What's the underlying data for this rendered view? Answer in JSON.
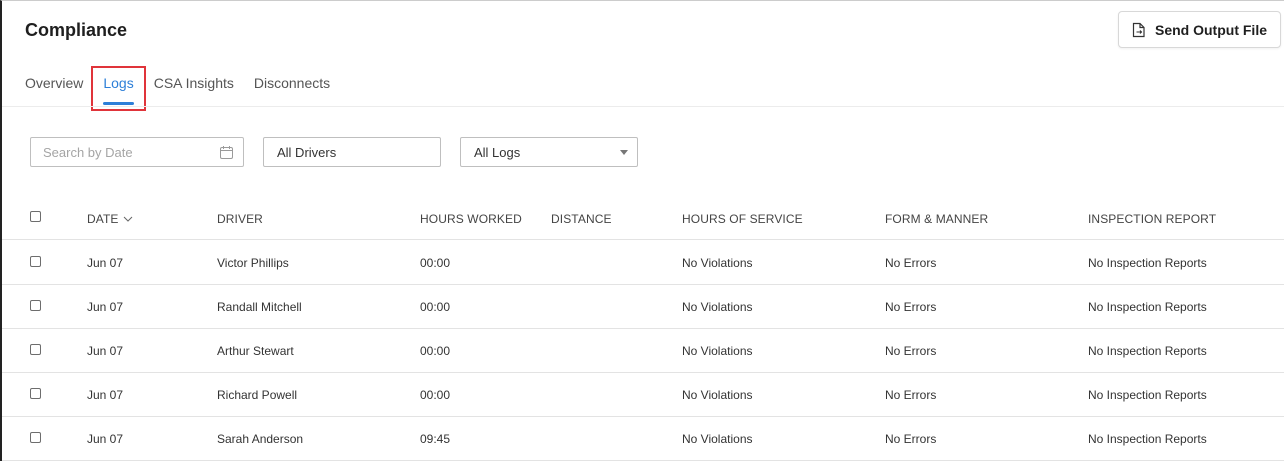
{
  "header": {
    "title": "Compliance",
    "send_button_label": "Send Output File"
  },
  "tabs": [
    {
      "label": "Overview"
    },
    {
      "label": "Logs",
      "active": true
    },
    {
      "label": "CSA Insights"
    },
    {
      "label": "Disconnects"
    }
  ],
  "filters": {
    "date_placeholder": "Search by Date",
    "drivers_value": "All Drivers",
    "logs_value": "All Logs"
  },
  "table": {
    "columns": [
      "DATE",
      "DRIVER",
      "HOURS WORKED",
      "DISTANCE",
      "HOURS OF SERVICE",
      "FORM & MANNER",
      "INSPECTION REPORT"
    ],
    "rows": [
      {
        "date": "Jun 07",
        "driver": "Victor Phillips",
        "hours": "00:00",
        "distance": "",
        "hos": "No Violations",
        "form": "No Errors",
        "inspection": "No Inspection Reports"
      },
      {
        "date": "Jun 07",
        "driver": "Randall Mitchell",
        "hours": "00:00",
        "distance": "",
        "hos": "No Violations",
        "form": "No Errors",
        "inspection": "No Inspection Reports"
      },
      {
        "date": "Jun 07",
        "driver": "Arthur Stewart",
        "hours": "00:00",
        "distance": "",
        "hos": "No Violations",
        "form": "No Errors",
        "inspection": "No Inspection Reports"
      },
      {
        "date": "Jun 07",
        "driver": "Richard Powell",
        "hours": "00:00",
        "distance": "",
        "hos": "No Violations",
        "form": "No Errors",
        "inspection": "No Inspection Reports"
      },
      {
        "date": "Jun 07",
        "driver": "Sarah Anderson",
        "hours": "09:45",
        "distance": "",
        "hos": "No Violations",
        "form": "No Errors",
        "inspection": "No Inspection Reports"
      }
    ]
  },
  "icons": {
    "send": "file-export-icon",
    "calendar": "calendar-icon",
    "dropdown": "caret-down-icon",
    "sort": "chevron-down-icon"
  },
  "colors": {
    "accent": "#2d7fd8",
    "highlight": "#e0343a"
  }
}
